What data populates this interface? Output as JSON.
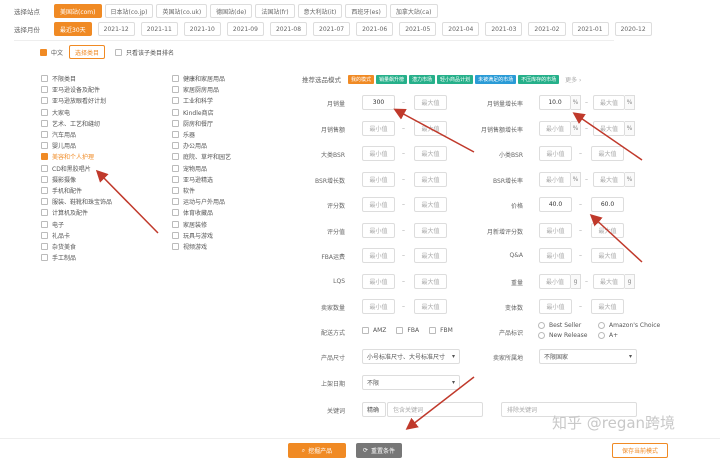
{
  "stations": {
    "label": "选择站点",
    "items": [
      "美国站(com)",
      "日本站(co.jp)",
      "英国站(co.uk)",
      "德国站(de)",
      "法国站(fr)",
      "意大利站(it)",
      "西班牙(es)",
      "加拿大站(ca)"
    ],
    "active_index": 0
  },
  "months": {
    "label": "选择月份",
    "items": [
      "最近30天",
      "2021-12",
      "2021-11",
      "2021-10",
      "2021-09",
      "2021-08",
      "2021-07",
      "2021-06",
      "2021-05",
      "2021-04",
      "2021-03",
      "2021-02",
      "2021-01",
      "2020-12"
    ],
    "active_index": 0
  },
  "category_mode": {
    "chinese_label": "中文",
    "select_category_button": "选择类目",
    "only_first_level_label": "只看该子类目排名"
  },
  "categories_col1": [
    "不限类目",
    "亚马逊设备及配件",
    "亚马逊放眼看好计划",
    "大家电",
    "艺术、工艺和缝纫",
    "汽车用品",
    "婴儿用品",
    "美容和个人护理",
    "CD和黑胶唱片",
    "摄影摄像",
    "手机和配件",
    "服装、鞋靴和珠宝饰品",
    "计算机及配件",
    "电子",
    "礼品卡",
    "杂货美食",
    "手工制品"
  ],
  "categories_col2": [
    "健康和家居用品",
    "家居厨房用品",
    "工业和科学",
    "Kindle商店",
    "厨房和餐厅",
    "乐器",
    "办公用品",
    "庭院、草坪和园艺",
    "宠物用品",
    "亚马逊精选",
    "软件",
    "运动与户外用品",
    "体育收藏品",
    "家居装修",
    "玩具与游戏",
    "视频游戏"
  ],
  "checked_category": "美容和个人护理",
  "recommend": {
    "label": "推荐选品模式",
    "modes": [
      "我的模式",
      "销量飙升榜",
      "潜力市场",
      "轻小商品计划",
      "未被满足的市场",
      "不压库存的市场"
    ],
    "more": "更多 ›",
    "colors": [
      "#f08a24",
      "#26b08a",
      "#26b08a",
      "#26b08a",
      "#2a9bd6",
      "#26b08a"
    ]
  },
  "filters": {
    "monthly_sales": {
      "label": "月销量",
      "min": "300",
      "max_placeholder": "最大值"
    },
    "sales_growth": {
      "label": "月销量增长率",
      "min": "10.0",
      "max_placeholder": "最大值",
      "unit": "%"
    },
    "monthly_revenue": {
      "label": "月销售额",
      "min_placeholder": "最小值",
      "max_placeholder": "最大值"
    },
    "revenue_growth": {
      "label": "月销售额增长率",
      "min_placeholder": "最小值",
      "max_placeholder": "最大值",
      "unit": "%"
    },
    "main_bsr": {
      "label": "大类BSR",
      "min_placeholder": "最小值",
      "max_placeholder": "最大值"
    },
    "sub_bsr": {
      "label": "小类BSR",
      "min_placeholder": "最小值",
      "max_placeholder": "最大值"
    },
    "bsr_growth": {
      "label": "BSR增长数",
      "min_placeholder": "最小值",
      "max_placeholder": "最大值"
    },
    "bsr_growth_rate": {
      "label": "BSR增长率",
      "min_placeholder": "最小值",
      "max_placeholder": "最大值",
      "unit": "%"
    },
    "ratings_count": {
      "label": "评分数",
      "min_placeholder": "最小值",
      "max_placeholder": "最大值"
    },
    "price": {
      "label": "价格",
      "min": "40.0",
      "max": "60.0"
    },
    "rating": {
      "label": "评分值",
      "min_placeholder": "最小值",
      "max_placeholder": "最大值"
    },
    "monthly_new_ratings": {
      "label": "月新增评分数",
      "min_placeholder": "最小值",
      "max_placeholder": "最大值"
    },
    "fba_fee": {
      "label": "FBA运费",
      "min_placeholder": "最小值",
      "max_placeholder": "最大值"
    },
    "qa": {
      "label": "Q&A",
      "min_placeholder": "最小值",
      "max_placeholder": "最大值"
    },
    "lqs": {
      "label": "LQS",
      "min_placeholder": "最小值",
      "max_placeholder": "最大值"
    },
    "weight": {
      "label": "重量",
      "min_placeholder": "最小值",
      "max_placeholder": "最大值",
      "unit": "g"
    },
    "seller_count": {
      "label": "卖家数量",
      "min_placeholder": "最小值",
      "max_placeholder": "最大值"
    },
    "variants": {
      "label": "变体数",
      "min_placeholder": "最小值",
      "max_placeholder": "最大值"
    }
  },
  "fulfillment": {
    "label": "配送方式",
    "options": [
      "AMZ",
      "FBA",
      "FBM"
    ]
  },
  "product_tags": {
    "label": "产品标识",
    "options": [
      "Best Seller",
      "Amazon's Choice",
      "New Release",
      "A+"
    ]
  },
  "product_size": {
    "label": "产品尺寸",
    "value": "小号标准尺寸、大号标准尺寸"
  },
  "seller_location": {
    "label": "卖家所属地",
    "value": "不限国家"
  },
  "launch_date": {
    "label": "上架日期",
    "value": "不限"
  },
  "keyword": {
    "label": "关键词",
    "mode": "精确",
    "include_placeholder": "包含关键词",
    "exclude_placeholder": "排除关键词"
  },
  "actions": {
    "search": "挖掘产品",
    "reset": "重置条件",
    "save": "保存当前模式"
  },
  "watermark": "知乎 @regan跨境"
}
